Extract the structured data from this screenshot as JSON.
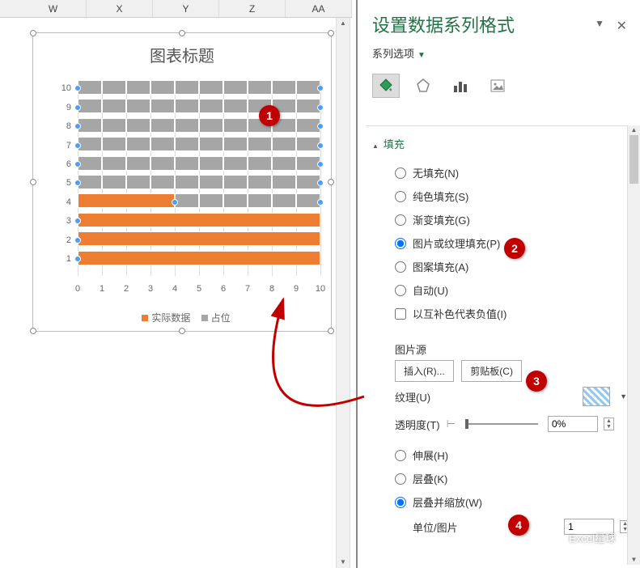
{
  "columns": [
    "W",
    "X",
    "Y",
    "Z",
    "AA"
  ],
  "chart": {
    "title": "图表标题",
    "legend": {
      "series1": "实际数据",
      "series2": "占位"
    }
  },
  "chart_data": {
    "type": "bar",
    "orientation": "horizontal",
    "stacked": true,
    "categories": [
      "1",
      "2",
      "3",
      "4",
      "5",
      "6",
      "7",
      "8",
      "9",
      "10"
    ],
    "series": [
      {
        "name": "实际数据",
        "color": "#ed7d31",
        "values": [
          10,
          10,
          10,
          4,
          0,
          0,
          0,
          0,
          0,
          0
        ]
      },
      {
        "name": "占位",
        "color": "#a6a6a6",
        "values": [
          0,
          0,
          0,
          6,
          10,
          10,
          10,
          10,
          10,
          10
        ]
      }
    ],
    "xlabel": "",
    "ylabel": "",
    "xlim": [
      0,
      10
    ],
    "x_ticks": [
      "0",
      "1",
      "2",
      "3",
      "4",
      "5",
      "6",
      "7",
      "8",
      "9",
      "10"
    ]
  },
  "panel": {
    "title": "设置数据系列格式",
    "dropdown": "系列选项",
    "section_fill": "填充",
    "fill_none": "无填充(N)",
    "fill_solid": "纯色填充(S)",
    "fill_gradient": "渐变填充(G)",
    "fill_picture": "图片或纹理填充(P)",
    "fill_pattern": "图案填充(A)",
    "fill_auto": "自动(U)",
    "fill_invert": "以互补色代表负值(I)",
    "pic_source": "图片源",
    "btn_insert": "插入(R)...",
    "btn_clipboard": "剪贴板(C)",
    "texture": "纹理(U)",
    "transparency": "透明度(T)",
    "transparency_val": "0%",
    "stretch": "伸展(H)",
    "stack": "层叠(K)",
    "stack_scale": "层叠并缩放(W)",
    "unit_pic": "单位/图片",
    "unit_val": "1"
  },
  "callouts": {
    "c1": "1",
    "c2": "2",
    "c3": "3",
    "c4": "4"
  },
  "watermark": "Excel星球"
}
